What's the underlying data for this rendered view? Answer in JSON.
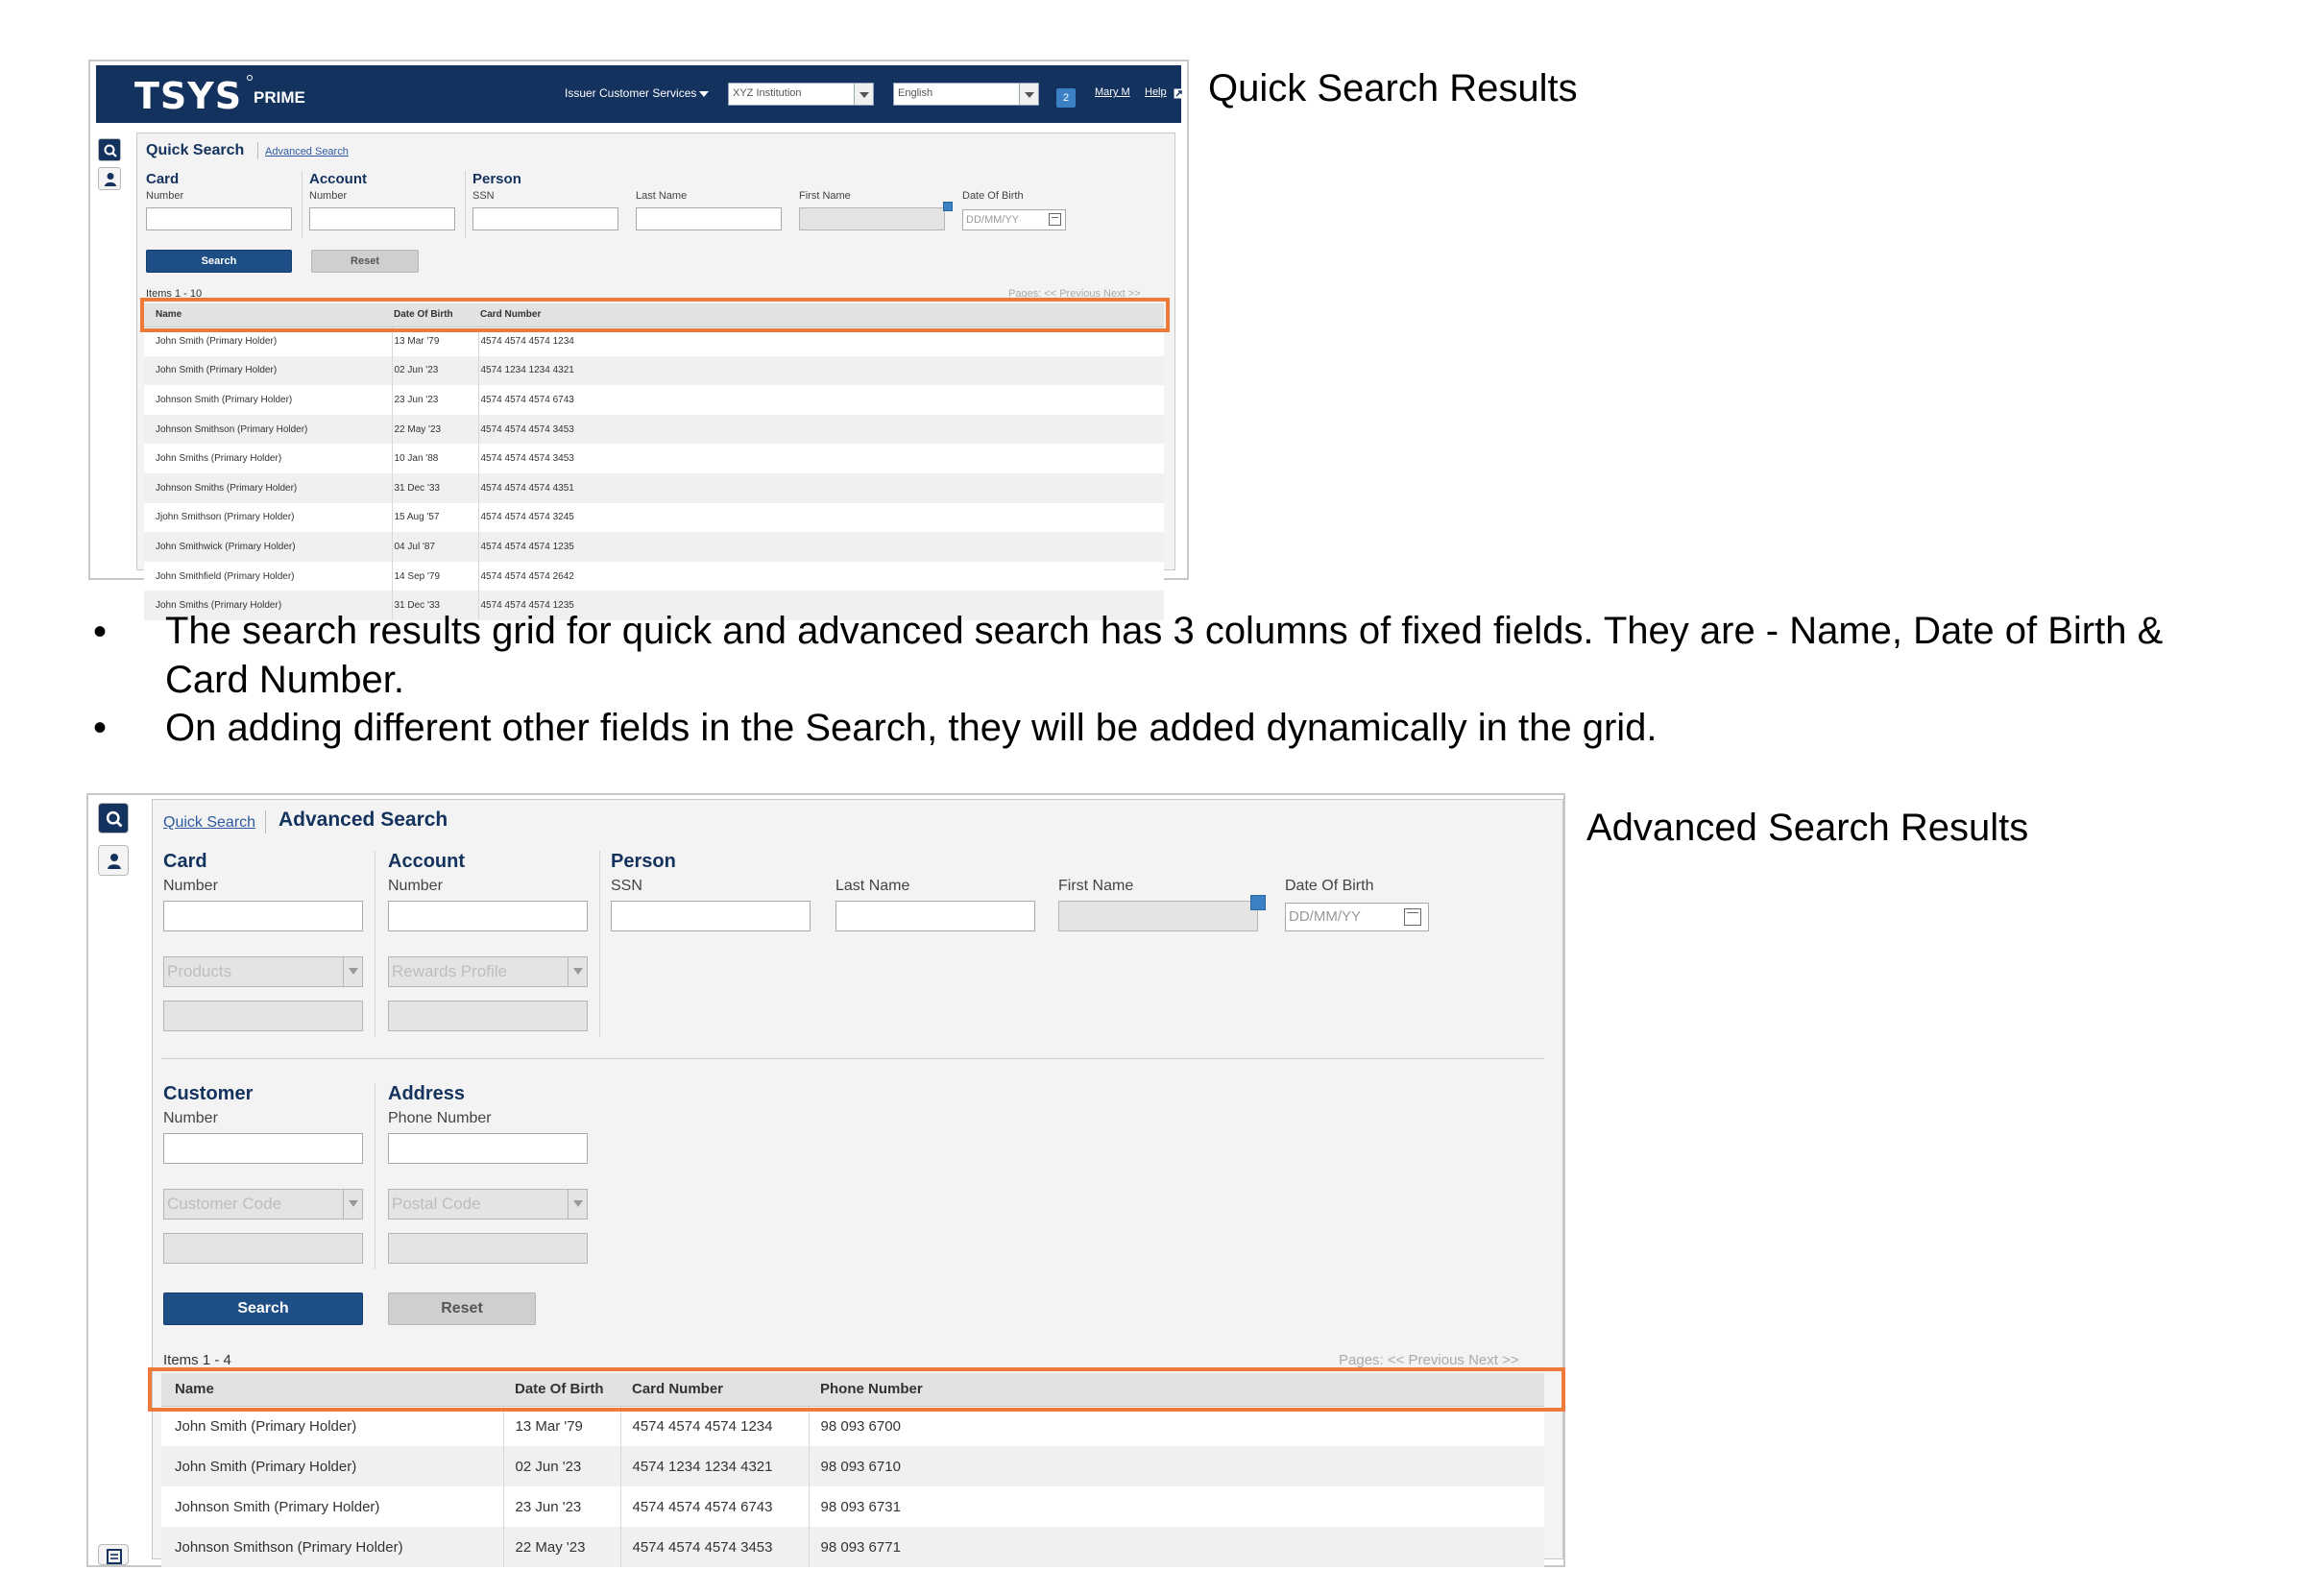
{
  "captions": {
    "quick": "Quick Search Results",
    "advanced": "Advanced Search Results"
  },
  "bullets": [
    "The search results grid for quick and advanced search has 3 columns of fixed fields. They are  - Name, Date of Birth & Card Number.",
    "On adding different other fields in the Search, they will be added dynamically in the grid."
  ],
  "header": {
    "logo": "TSYS",
    "product": "PRIME",
    "service": "Issuer Customer Services",
    "institution": "XYZ Institution",
    "language": "English",
    "notifications": "2",
    "user": "Mary M",
    "help": "Help"
  },
  "quick": {
    "tab_active": "Quick Search",
    "tab_link": "Advanced Search",
    "groups": {
      "card": {
        "title": "Card",
        "label": "Number"
      },
      "account": {
        "title": "Account",
        "label": "Number"
      },
      "person": {
        "title": "Person",
        "ssn": "SSN",
        "last_name": "Last Name",
        "first_name": "First Name",
        "dob": "Date Of Birth",
        "dob_placeholder": "DD/MM/YY"
      }
    },
    "search_label": "Search",
    "reset_label": "Reset",
    "items": "Items 1 - 10",
    "pager": "Pages:   << Previous   Next  >>",
    "columns": [
      "Name",
      "Date Of Birth",
      "Card Number"
    ],
    "rows": [
      [
        "John Smith (Primary Holder)",
        "13 Mar '79",
        "4574 4574 4574 1234"
      ],
      [
        "John Smith (Primary Holder)",
        "02 Jun '23",
        "4574 1234 1234 4321"
      ],
      [
        "Johnson Smith (Primary Holder)",
        "23 Jun '23",
        "4574 4574 4574 6743"
      ],
      [
        "Johnson Smithson (Primary Holder)",
        "22 May '23",
        "4574 4574 4574 3453"
      ],
      [
        "John Smiths (Primary Holder)",
        "10 Jan '88",
        "4574 4574 4574 3453"
      ],
      [
        "Johnson Smiths (Primary Holder)",
        "31 Dec '33",
        "4574 4574 4574 4351"
      ],
      [
        "Jjohn Smithson (Primary Holder)",
        "15 Aug '57",
        "4574 4574 4574 3245"
      ],
      [
        "John Smithwick (Primary Holder)",
        "04 Jul '87",
        "4574 4574 4574 1235"
      ],
      [
        "John Smithfield (Primary Holder)",
        "14 Sep '79",
        "4574 4574 4574 2642"
      ],
      [
        "John Smiths (Primary Holder)",
        "31 Dec '33",
        "4574 4574 4574 1235"
      ]
    ]
  },
  "advanced": {
    "tab_link": "Quick Search",
    "tab_active": "Advanced Search",
    "groups": {
      "card": {
        "title": "Card",
        "label": "Number",
        "products": "Products"
      },
      "account": {
        "title": "Account",
        "label": "Number",
        "rewards": "Rewards Profile"
      },
      "person": {
        "title": "Person",
        "ssn": "SSN",
        "last_name": "Last Name",
        "first_name": "First Name",
        "dob": "Date Of Birth",
        "dob_placeholder": "DD/MM/YY"
      },
      "customer": {
        "title": "Customer",
        "label": "Number",
        "code": "Customer Code"
      },
      "address": {
        "title": "Address",
        "label": "Phone Number",
        "postal": "Postal Code"
      }
    },
    "search_label": "Search",
    "reset_label": "Reset",
    "items": "Items 1 - 4",
    "pager": "Pages:   << Previous   Next  >>",
    "columns": [
      "Name",
      "Date Of Birth",
      "Card Number",
      "Phone Number"
    ],
    "rows": [
      [
        "John Smith (Primary Holder)",
        "13 Mar '79",
        "4574 4574 4574 1234",
        "98 093 6700"
      ],
      [
        "John Smith (Primary Holder)",
        "02 Jun '23",
        "4574 1234 1234 4321",
        "98 093 6710"
      ],
      [
        "Johnson Smith (Primary Holder)",
        "23 Jun '23",
        "4574 4574 4574 6743",
        "98 093 6731"
      ],
      [
        "Johnson Smithson (Primary Holder)",
        "22 May '23",
        "4574 4574 4574 3453",
        "98 093 6771"
      ]
    ]
  },
  "colors": {
    "brand_navy": "#14325e",
    "button_blue": "#1e4e86",
    "highlight_orange": "#ee7a3a"
  },
  "icons": [
    "search-icon",
    "person-icon",
    "calendar-icon",
    "note-icon",
    "chevron-down-icon",
    "external-link-icon",
    "list-icon"
  ]
}
